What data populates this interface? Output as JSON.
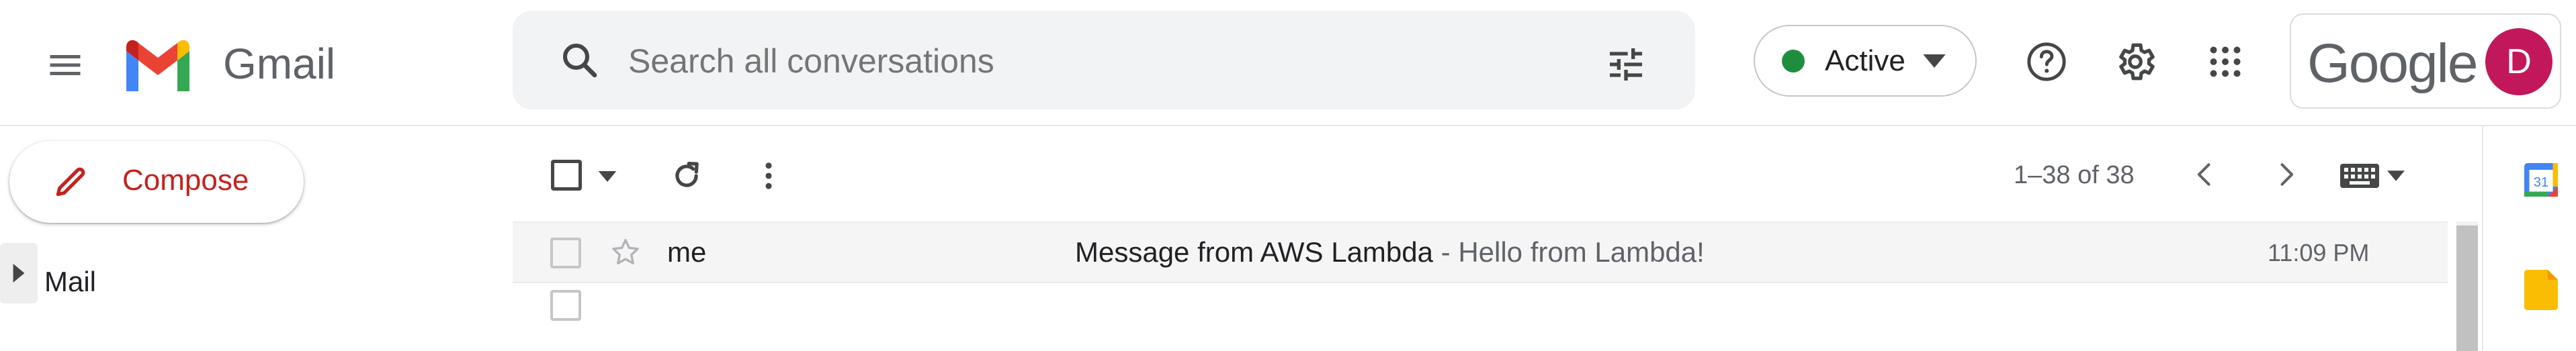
{
  "header": {
    "logo_text": "Gmail",
    "search_placeholder": "Search all conversations",
    "status": {
      "label": "Active",
      "dot_color": "#1e8e3e"
    },
    "account": {
      "wordmark": "Google",
      "avatar_letter": "D",
      "avatar_color": "#c2185b"
    }
  },
  "nav": {
    "compose_label": "Compose",
    "sections": [
      {
        "label": "Mail"
      }
    ]
  },
  "toolbar": {
    "pagination": "1–38 of 38"
  },
  "emails": [
    {
      "sender": "me",
      "subject": "Message from AWS Lambda",
      "snippet": " - Hello from Lambda!",
      "time": "11:09 PM"
    }
  ],
  "side_panel": {
    "calendar_day": "31"
  },
  "icons": {
    "menu": "menu-icon",
    "search": "search-icon",
    "options": "tune-icon",
    "help": "help-icon",
    "settings": "gear-icon",
    "apps": "apps-grid-icon"
  }
}
